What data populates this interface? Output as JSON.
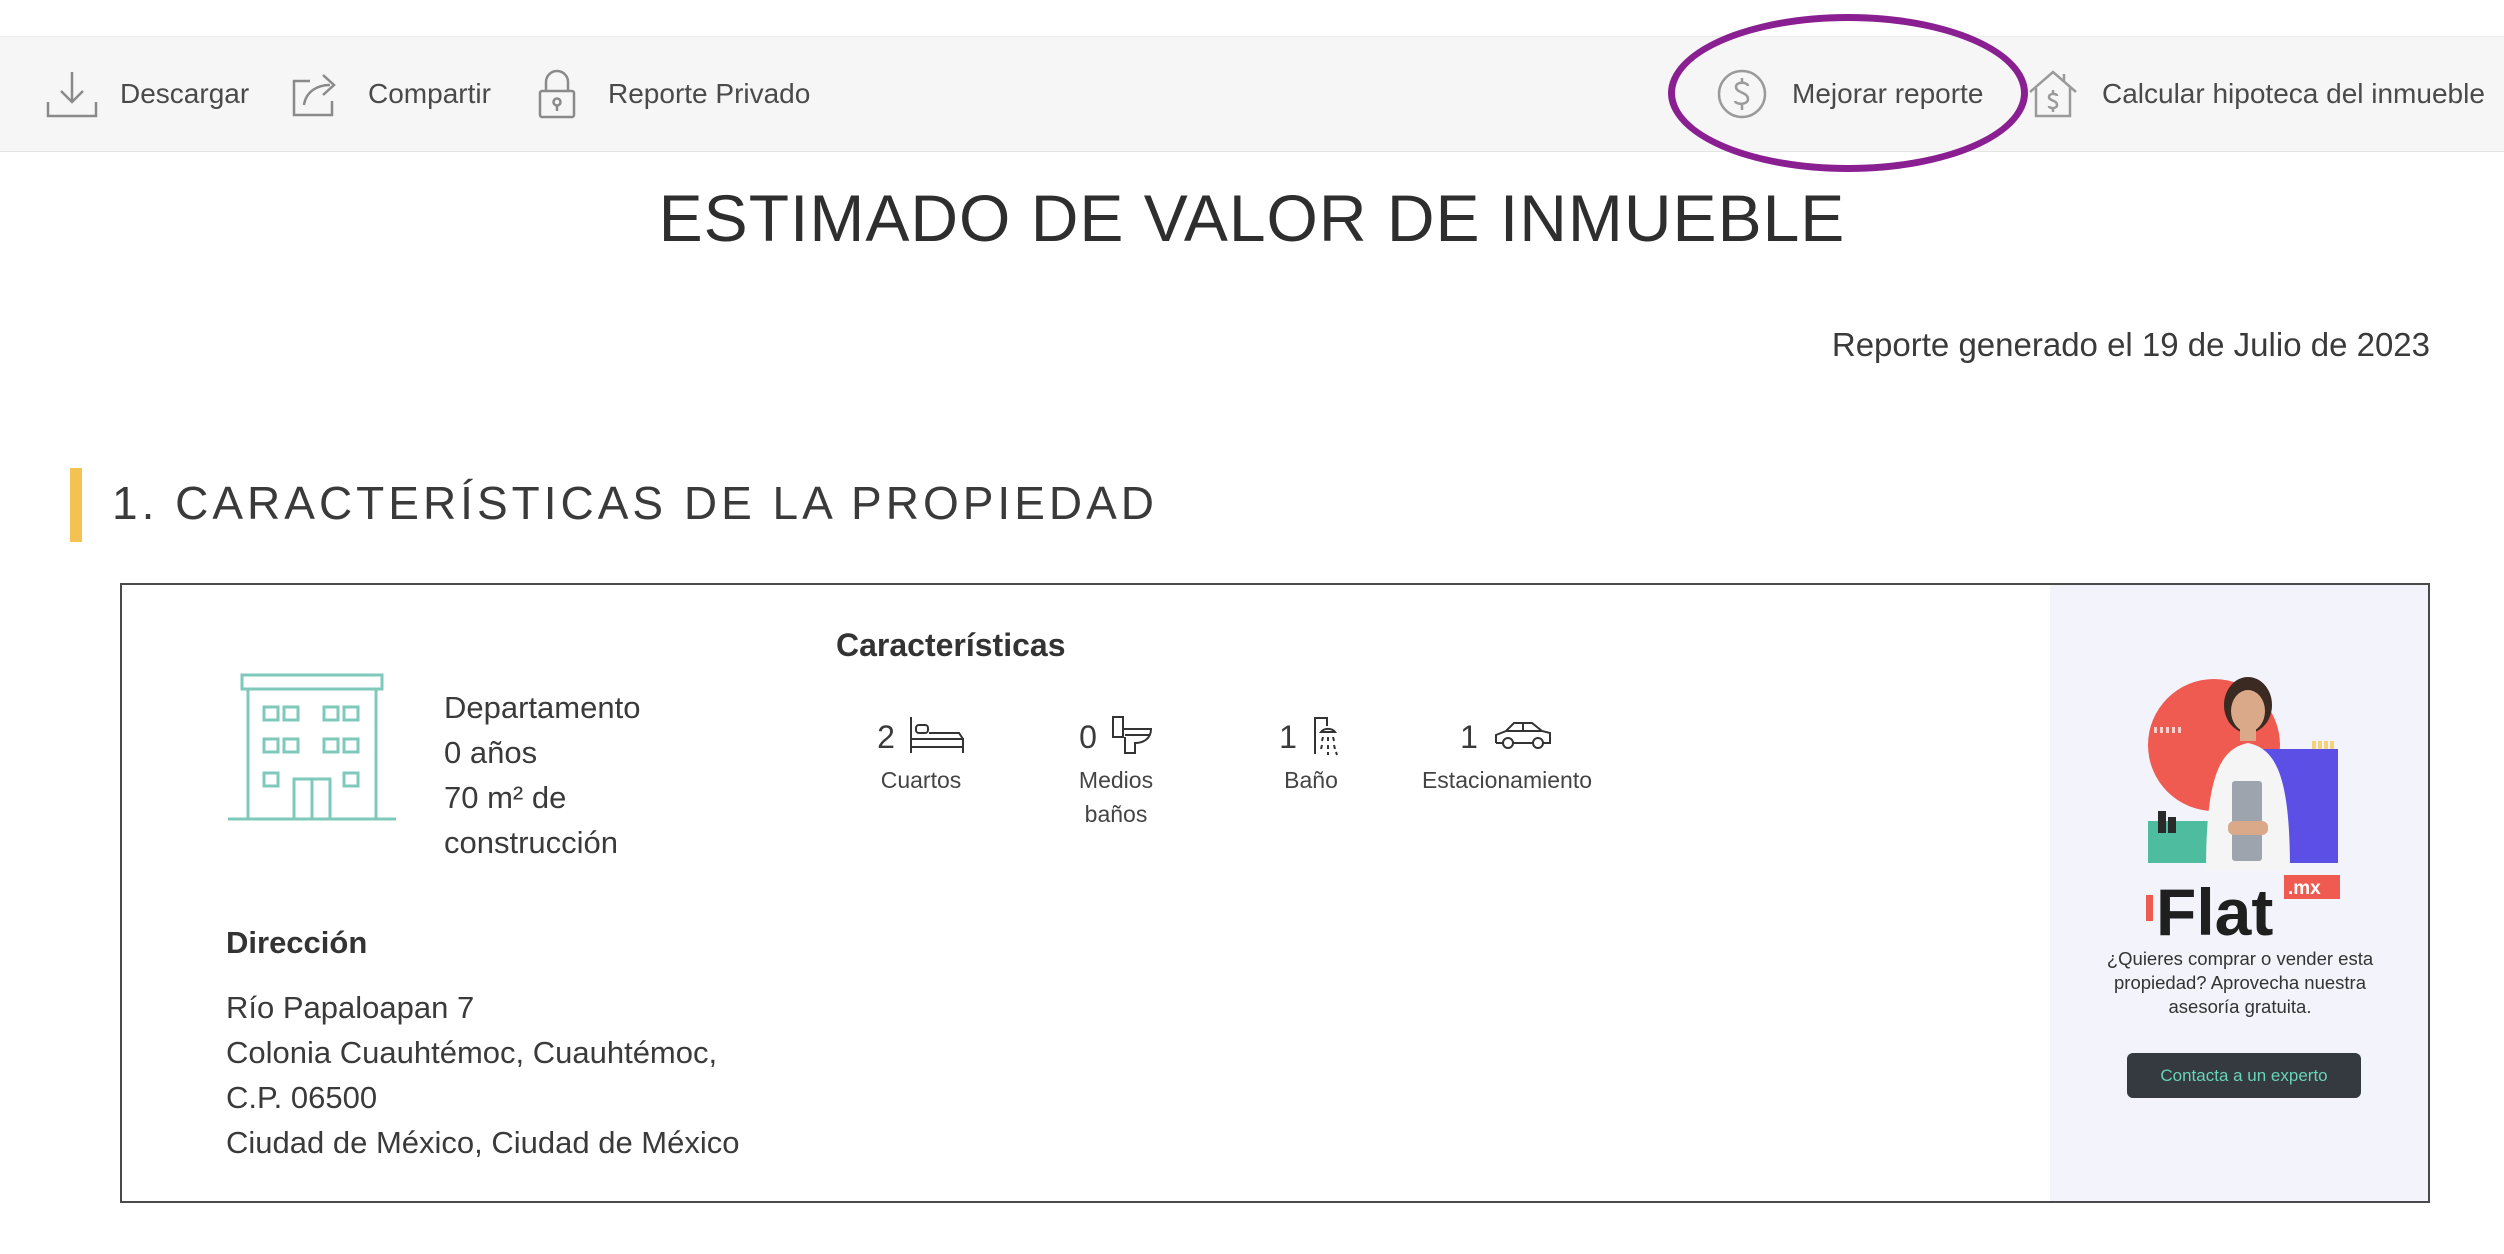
{
  "toolbar": {
    "download_label": "Descargar",
    "share_label": "Compartir",
    "private_label": "Reporte Privado",
    "improve_label": "Mejorar reporte",
    "mortgage_label": "Calcular hipoteca del inmueble"
  },
  "page": {
    "title": "ESTIMADO DE VALOR DE INMUEBLE",
    "report_date": "Reporte generado el 19 de Julio de 2023"
  },
  "section": {
    "title": "1. CARACTERÍSTICAS DE LA PROPIEDAD"
  },
  "property": {
    "type": "Departamento",
    "age": "0 años",
    "area_line1": "70 m² de",
    "area_line2": "construcción"
  },
  "features": {
    "title": "Características",
    "items": [
      {
        "value": "2",
        "label_line1": "Cuartos",
        "label_line2": "",
        "icon": "bed-icon"
      },
      {
        "value": "0",
        "label_line1": "Medios",
        "label_line2": "baños",
        "icon": "toilet-icon"
      },
      {
        "value": "1",
        "label_line1": "Baño",
        "label_line2": "",
        "icon": "shower-icon"
      },
      {
        "value": "1",
        "label_line1": "Estacionamiento",
        "label_line2": "",
        "icon": "car-icon"
      }
    ]
  },
  "address": {
    "title": "Dirección",
    "line1": "Río Papaloapan 7",
    "line2": "Colonia Cuauhtémoc, Cuauhtémoc,",
    "line3": "C.P. 06500",
    "line4": "Ciudad de México, Ciudad de México"
  },
  "promo": {
    "brand": "Flat",
    "brand_suffix": ".mx",
    "text_line1": "¿Quieres comprar o vender esta",
    "text_line2": "propiedad? Aprovecha nuestra",
    "text_line3": "asesoría gratuita.",
    "button_label": "Contacta a un experto"
  },
  "colors": {
    "highlight": "#8a1f92",
    "section_accent": "#f3c253",
    "building_icon": "#7fc9bb",
    "promo_button": "#343a40",
    "promo_button_text": "#69d3b5"
  }
}
